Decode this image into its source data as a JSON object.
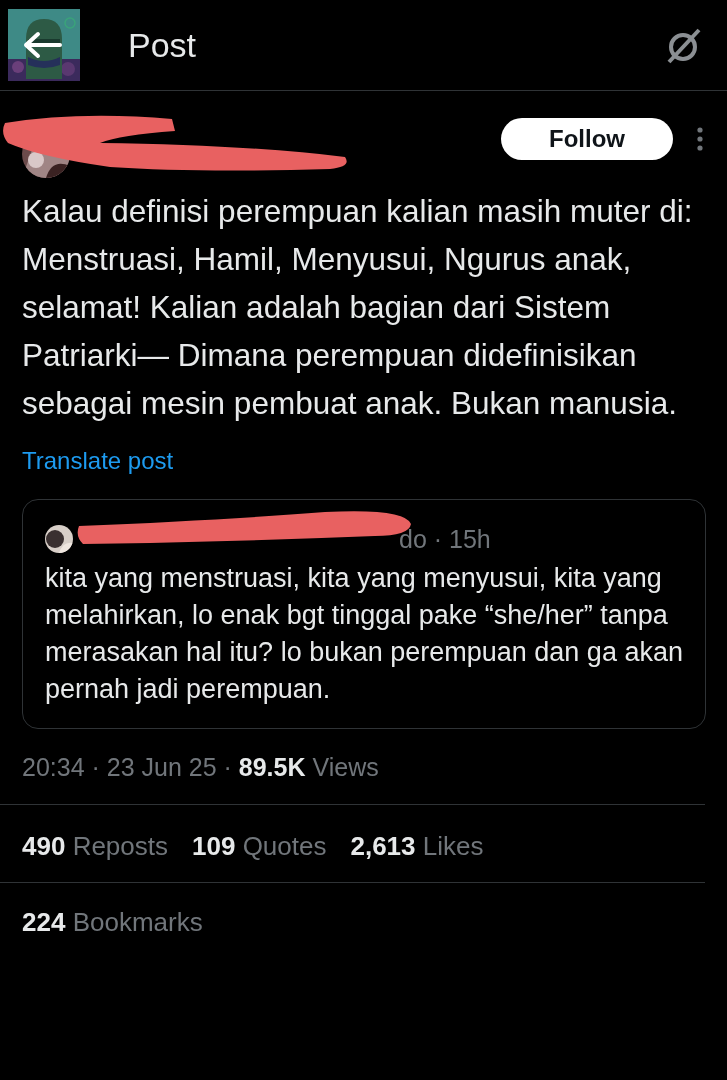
{
  "header": {
    "title": "Post"
  },
  "post": {
    "follow_button": "Follow",
    "text": "Kalau definisi perempuan kalian masih muter di: Menstruasi, Hamil, Menyusui, Ngurus anak, selamat! Kalian adalah bagian dari Sistem Patriarki— Dimana perempuan didefinisikan sebagai mesin pembuat anak. Bukan manusia.",
    "translate_link": "Translate post",
    "quote": {
      "handle_time": "do · 15h",
      "text": "kita yang menstruasi, kita yang menyusui, kita yang melahirkan, lo enak bgt tinggal pake “she/her” tanpa merasakan hal itu? lo bukan perempuan dan ga akan pernah jadi perempuan."
    },
    "meta": "20:34 · 23 Jun 25 · **89.5K** Views",
    "stats": [
      {
        "count": "490",
        "label": "Reposts"
      },
      {
        "count": "109",
        "label": "Quotes"
      },
      {
        "count": "2,613",
        "label": "Likes"
      }
    ],
    "bookmarks": {
      "count": "224",
      "label": "Bookmarks"
    }
  }
}
